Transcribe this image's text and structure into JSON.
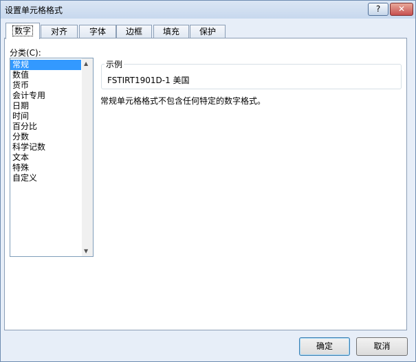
{
  "window": {
    "title": "设置单元格格式",
    "help_label": "?",
    "close_label": "✕"
  },
  "tabs": [
    {
      "label": "数字"
    },
    {
      "label": "对齐"
    },
    {
      "label": "字体"
    },
    {
      "label": "边框"
    },
    {
      "label": "填充"
    },
    {
      "label": "保护"
    }
  ],
  "category": {
    "label": "分类(C):",
    "selected": "常规",
    "items": [
      "常规",
      "数值",
      "货币",
      "会计专用",
      "日期",
      "时间",
      "百分比",
      "分数",
      "科学记数",
      "文本",
      "特殊",
      "自定义"
    ]
  },
  "sample": {
    "legend": "示例",
    "value": "FSTIRT1901D-1 美国"
  },
  "description": "常规单元格格式不包含任何特定的数字格式。",
  "buttons": {
    "ok": "确定",
    "cancel": "取消"
  },
  "icons": {
    "help": "help-icon",
    "close": "close-icon",
    "scroll_up": "triangle-up",
    "scroll_down": "triangle-down"
  }
}
